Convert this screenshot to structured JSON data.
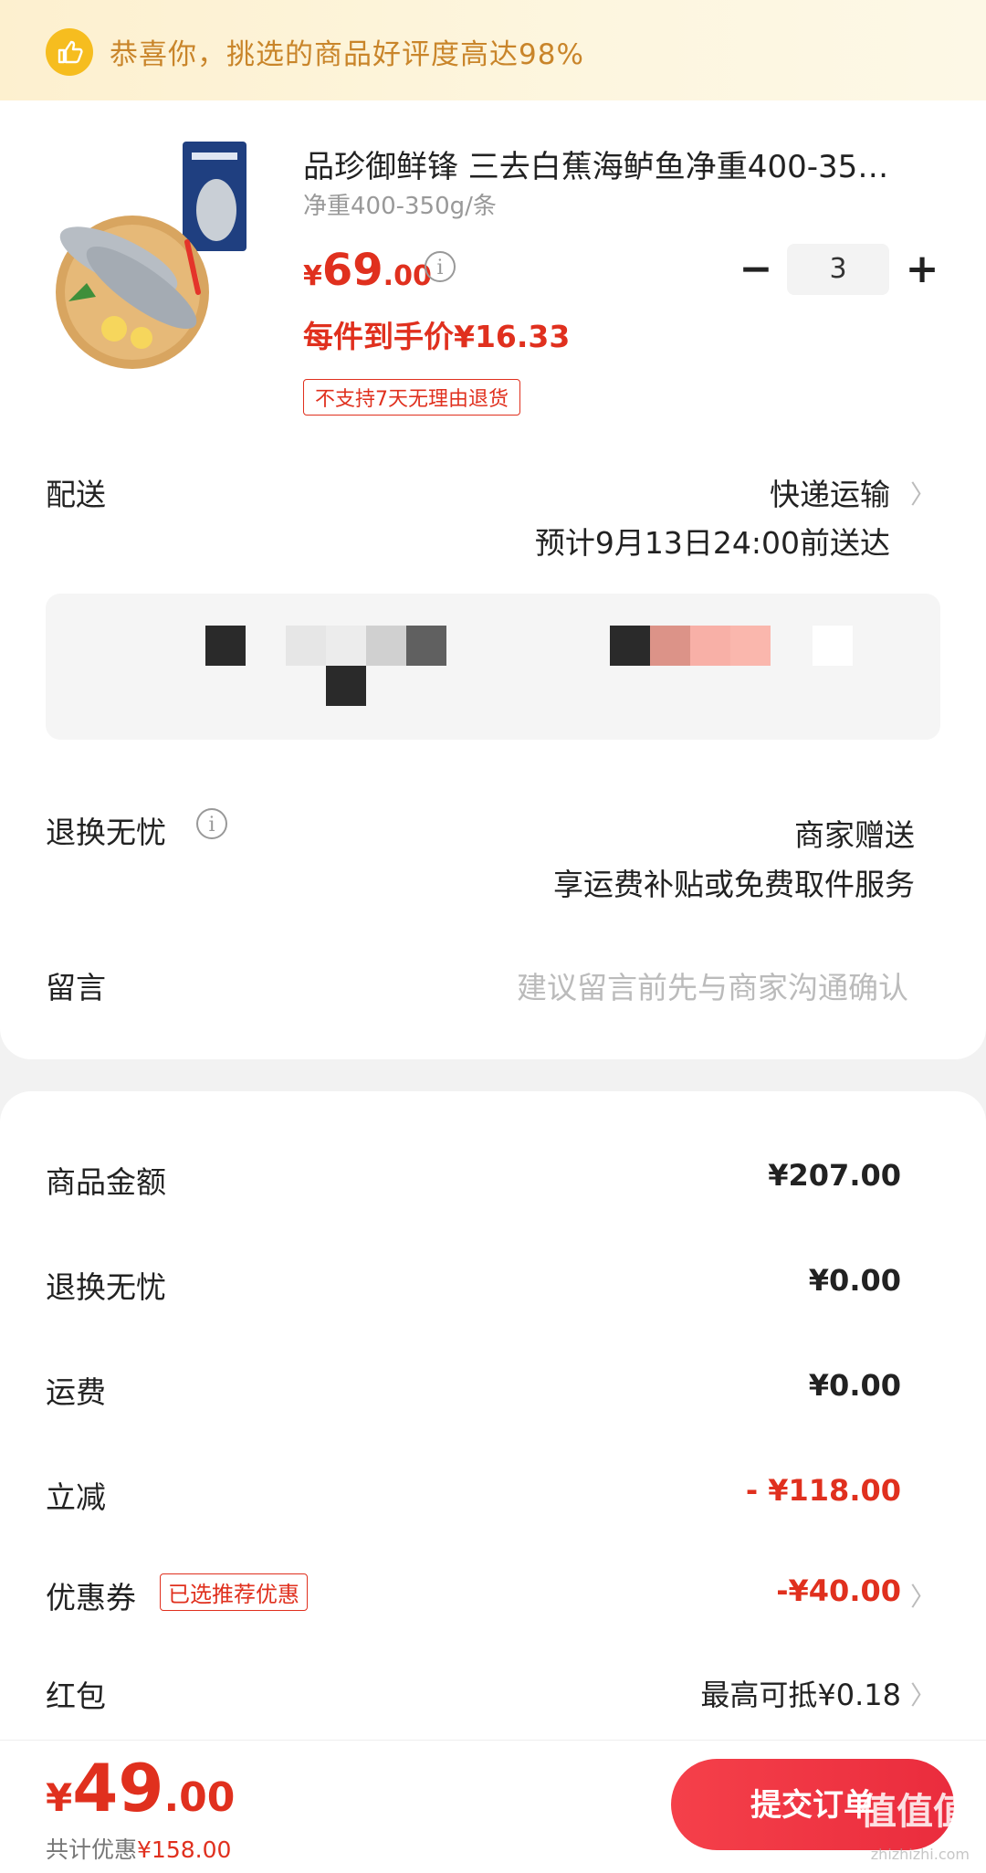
{
  "banner": {
    "text": "恭喜你，挑选的商品好评度高达98%"
  },
  "product": {
    "title": "品珍御鲜锋 三去白蕉海鲈鱼净重400-35…",
    "spec": "净重400-350g/条",
    "price_symbol": "¥",
    "price_int": "69",
    "price_dec": ".00",
    "quantity": "3",
    "unit_price": "每件到手价¥16.33",
    "return_tag": "不支持7天无理由退货"
  },
  "delivery": {
    "label": "配送",
    "method": "快递运输",
    "eta": "预计9月13日24:00前送达"
  },
  "exchange": {
    "label": "退换无忧",
    "value": "商家赠送",
    "desc": "享运费补贴或免费取件服务"
  },
  "message": {
    "label": "留言",
    "placeholder": "建议留言前先与商家沟通确认"
  },
  "fees": {
    "goods_label": "商品金额",
    "goods_value": "¥207.00",
    "exchange_label": "退换无忧",
    "exchange_value": "¥0.00",
    "shipping_label": "运费",
    "shipping_value": "¥0.00",
    "discount_label": "立减",
    "discount_value": "- ¥118.00",
    "coupon_label": "优惠券",
    "coupon_tag": "已选推荐优惠",
    "coupon_value": "-¥40.00",
    "redpacket_label": "红包",
    "redpacket_value": "最高可抵¥0.18"
  },
  "footer": {
    "total_symbol": "¥",
    "total_int": "49",
    "total_dec": ".00",
    "saved_prefix": "共计优惠",
    "saved_value": "¥158.00",
    "submit_label": "提交订单"
  },
  "watermark": {
    "main": "值值值",
    "sub": "zhizhizhi.com"
  },
  "colors": {
    "accent": "#e0301e",
    "banner_text": "#c9852a",
    "banner_bg": "#fdf3d8",
    "button": "#f13c47"
  }
}
